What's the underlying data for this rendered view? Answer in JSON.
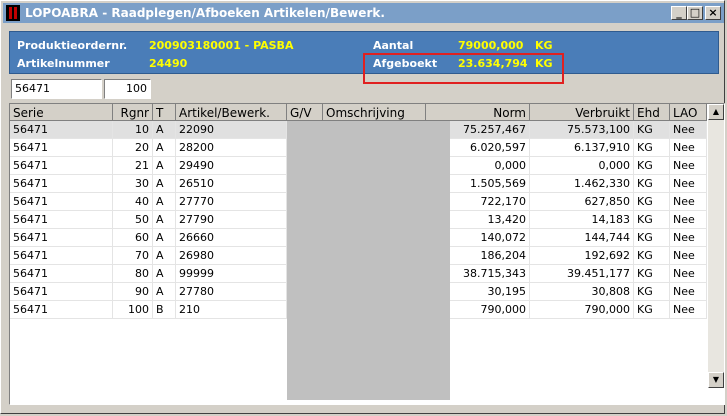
{
  "window": {
    "title": "LOPOABRA - Raadplegen/Afboeken Artikelen/Bewerk.",
    "minimize_glyph": "_",
    "maximize_glyph": "□",
    "close_glyph": "×"
  },
  "info": {
    "productieorder_label": "Produktieordernr.",
    "productieorder_value": "200903180001 - PASBA",
    "artikelnummer_label": "Artikelnummer",
    "artikelnummer_value": "24490",
    "aantal_label": "Aantal",
    "aantal_value": "79000,000",
    "aantal_unit": "KG",
    "afgeboekt_label": "Afgeboekt",
    "afgeboekt_value": "23.634,794",
    "afgeboekt_unit": "KG"
  },
  "filters": {
    "serie": "56471",
    "rgnr": "100"
  },
  "table": {
    "columns": [
      "Serie",
      "Rgnr",
      "T",
      "Artikel/Bewerk.",
      "G/V",
      "Omschrijving",
      "Norm",
      "Verbruikt",
      "Ehd",
      "LAO"
    ],
    "rows": [
      {
        "serie": "56471",
        "rgnr": "10",
        "t": "A",
        "artikel": "22090",
        "norm": "75.257,467",
        "verbruikt": "75.573,100",
        "ehd": "KG",
        "lao": "Nee"
      },
      {
        "serie": "56471",
        "rgnr": "20",
        "t": "A",
        "artikel": "28200",
        "norm": "6.020,597",
        "verbruikt": "6.137,910",
        "ehd": "KG",
        "lao": "Nee"
      },
      {
        "serie": "56471",
        "rgnr": "21",
        "t": "A",
        "artikel": "29490",
        "norm": "0,000",
        "verbruikt": "0,000",
        "ehd": "KG",
        "lao": "Nee"
      },
      {
        "serie": "56471",
        "rgnr": "30",
        "t": "A",
        "artikel": "26510",
        "norm": "1.505,569",
        "verbruikt": "1.462,330",
        "ehd": "KG",
        "lao": "Nee"
      },
      {
        "serie": "56471",
        "rgnr": "40",
        "t": "A",
        "artikel": "27770",
        "norm": "722,170",
        "verbruikt": "627,850",
        "ehd": "KG",
        "lao": "Nee"
      },
      {
        "serie": "56471",
        "rgnr": "50",
        "t": "A",
        "artikel": "27790",
        "norm": "13,420",
        "verbruikt": "14,183",
        "ehd": "KG",
        "lao": "Nee"
      },
      {
        "serie": "56471",
        "rgnr": "60",
        "t": "A",
        "artikel": "26660",
        "norm": "140,072",
        "verbruikt": "144,744",
        "ehd": "KG",
        "lao": "Nee"
      },
      {
        "serie": "56471",
        "rgnr": "70",
        "t": "A",
        "artikel": "26980",
        "norm": "186,204",
        "verbruikt": "192,692",
        "ehd": "KG",
        "lao": "Nee"
      },
      {
        "serie": "56471",
        "rgnr": "80",
        "t": "A",
        "artikel": "99999",
        "norm": "38.715,343",
        "verbruikt": "39.451,177",
        "ehd": "KG",
        "lao": "Nee"
      },
      {
        "serie": "56471",
        "rgnr": "90",
        "t": "A",
        "artikel": "27780",
        "norm": "30,195",
        "verbruikt": "30,808",
        "ehd": "KG",
        "lao": "Nee"
      },
      {
        "serie": "56471",
        "rgnr": "100",
        "t": "B",
        "artikel": "210",
        "norm": "790,000",
        "verbruikt": "790,000",
        "ehd": "KG",
        "lao": "Nee"
      }
    ]
  },
  "scrollbar": {
    "up_glyph": "▲",
    "down_glyph": "▼"
  },
  "colors": {
    "title_bar": "#7b9fc8",
    "info_panel": "#4a7db8",
    "value_text": "#ffff00",
    "highlight_border": "#e02020"
  }
}
